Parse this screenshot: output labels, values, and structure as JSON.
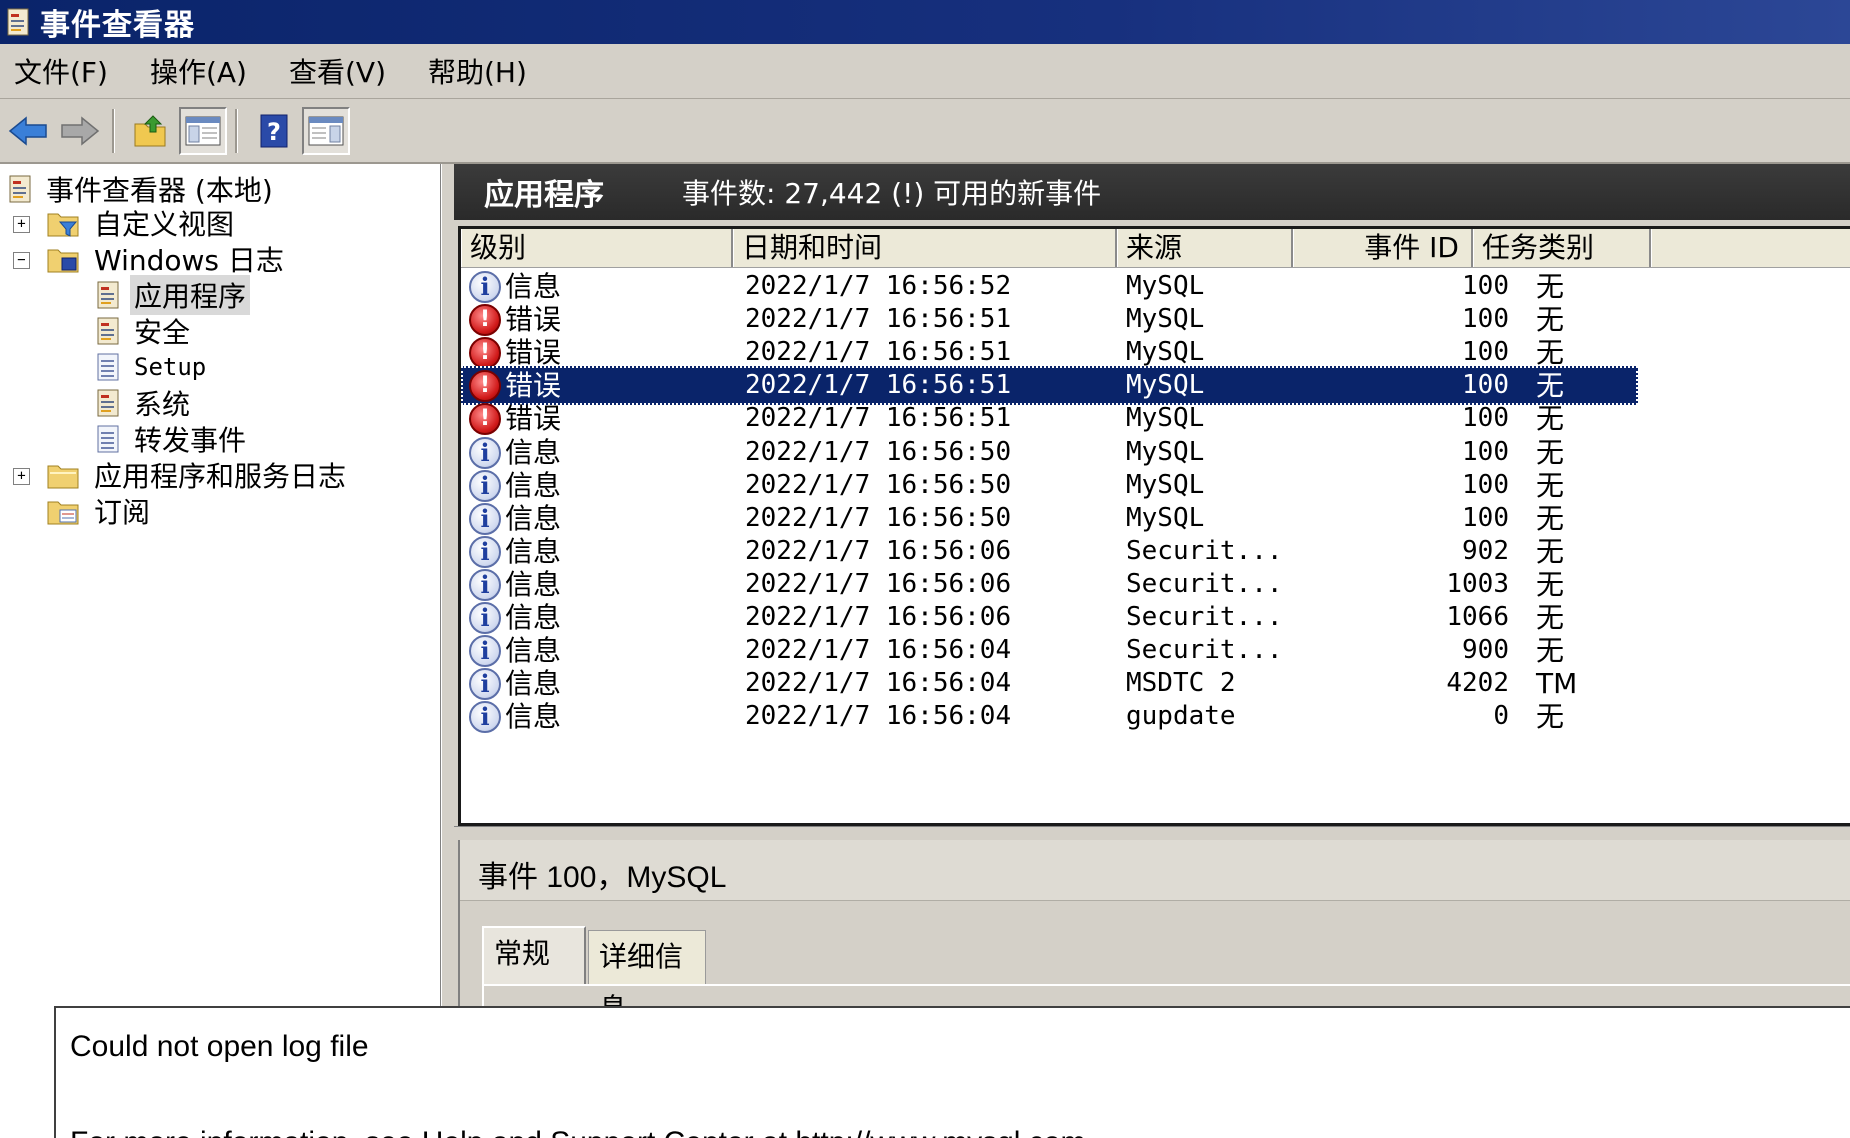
{
  "window": {
    "title": "事件查看器"
  },
  "menu": [
    "文件(F)",
    "操作(A)",
    "查看(V)",
    "帮助(H)"
  ],
  "toolbar": {
    "buttons": [
      "back-arrow-icon",
      "forward-arrow-icon",
      "up-folder-icon",
      "show-hide-console-tree-icon",
      "help-icon",
      "show-hide-action-pane-icon"
    ]
  },
  "tree": {
    "root": "事件查看器 (本地)",
    "custom_views": "自定义视图",
    "windows_logs": "Windows 日志",
    "application": "应用程序",
    "security": "安全",
    "setup": "Setup",
    "system": "系统",
    "forwarded": "转发事件",
    "app_service_logs": "应用程序和服务日志",
    "subscriptions": "订阅"
  },
  "log_header": {
    "title": "应用程序",
    "count": "事件数: 27,442 (!) 可用的新事件"
  },
  "columns": [
    "级别",
    "日期和时间",
    "来源",
    "事件 ID",
    "任务类别"
  ],
  "events": [
    {
      "level": "信息",
      "type": "info",
      "datetime": "2022/1/7 16:56:52",
      "source": "MySQL",
      "id": "100",
      "task": "无"
    },
    {
      "level": "错误",
      "type": "error",
      "datetime": "2022/1/7 16:56:51",
      "source": "MySQL",
      "id": "100",
      "task": "无"
    },
    {
      "level": "错误",
      "type": "error",
      "datetime": "2022/1/7 16:56:51",
      "source": "MySQL",
      "id": "100",
      "task": "无"
    },
    {
      "level": "错误",
      "type": "error",
      "datetime": "2022/1/7 16:56:51",
      "source": "MySQL",
      "id": "100",
      "task": "无",
      "selected": true
    },
    {
      "level": "错误",
      "type": "error",
      "datetime": "2022/1/7 16:56:51",
      "source": "MySQL",
      "id": "100",
      "task": "无"
    },
    {
      "level": "信息",
      "type": "info",
      "datetime": "2022/1/7 16:56:50",
      "source": "MySQL",
      "id": "100",
      "task": "无"
    },
    {
      "level": "信息",
      "type": "info",
      "datetime": "2022/1/7 16:56:50",
      "source": "MySQL",
      "id": "100",
      "task": "无"
    },
    {
      "level": "信息",
      "type": "info",
      "datetime": "2022/1/7 16:56:50",
      "source": "MySQL",
      "id": "100",
      "task": "无"
    },
    {
      "level": "信息",
      "type": "info",
      "datetime": "2022/1/7 16:56:06",
      "source": "Securit...",
      "id": "902",
      "task": "无"
    },
    {
      "level": "信息",
      "type": "info",
      "datetime": "2022/1/7 16:56:06",
      "source": "Securit...",
      "id": "1003",
      "task": "无"
    },
    {
      "level": "信息",
      "type": "info",
      "datetime": "2022/1/7 16:56:06",
      "source": "Securit...",
      "id": "1066",
      "task": "无"
    },
    {
      "level": "信息",
      "type": "info",
      "datetime": "2022/1/7 16:56:04",
      "source": "Securit...",
      "id": "900",
      "task": "无"
    },
    {
      "level": "信息",
      "type": "info",
      "datetime": "2022/1/7 16:56:04",
      "source": "MSDTC 2",
      "id": "4202",
      "task": "TM"
    },
    {
      "level": "信息",
      "type": "info",
      "datetime": "2022/1/7 16:56:04",
      "source": "gupdate",
      "id": "0",
      "task": "无"
    }
  ],
  "detail": {
    "title": "事件 100，MySQL",
    "tabs": [
      "常规",
      "详细信息"
    ],
    "message": "Could not open log file",
    "message_line2": "For more information, see Help and Support Center at http://www.mysql.com"
  },
  "colors": {
    "selection": "#0a246a",
    "titlebar": "#0a246a",
    "error": "#d11a1a",
    "info": "#1f3f9f"
  }
}
